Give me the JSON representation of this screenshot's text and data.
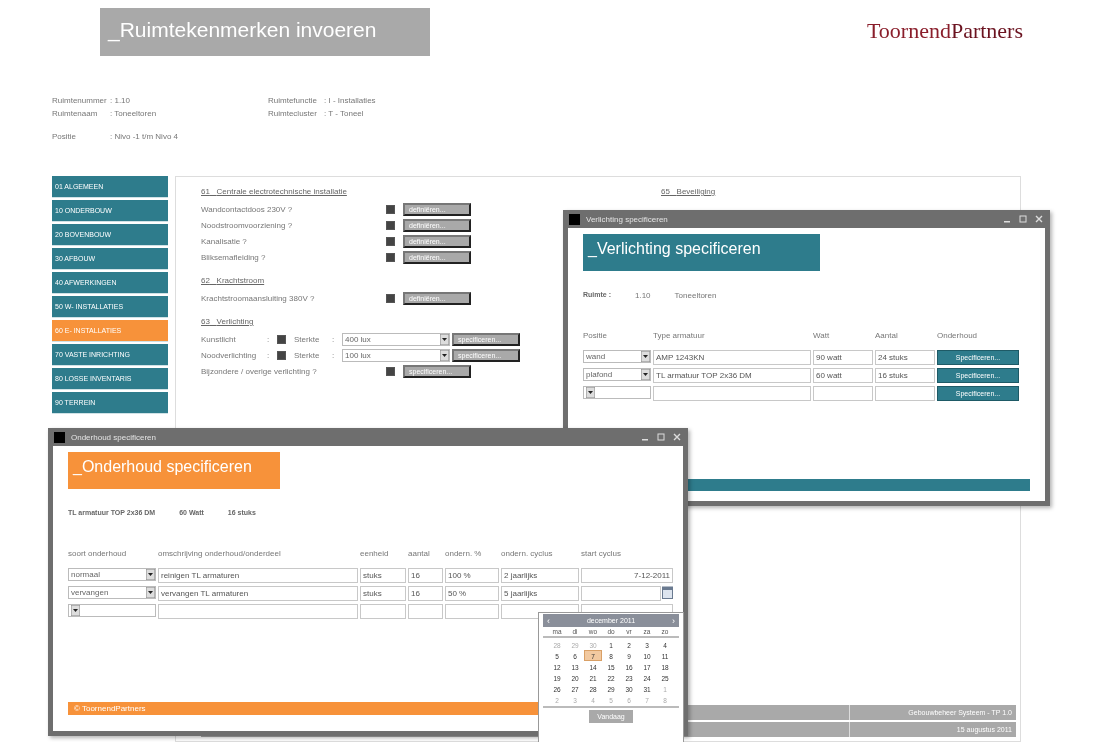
{
  "header": {
    "title": "_Ruimtekenmerken invoeren",
    "logo_first": "Toornend",
    "logo_second": "Partners"
  },
  "room_info": {
    "left": [
      {
        "label": "Ruimtenummer",
        "value": ": 1.10"
      },
      {
        "label": "Ruimtenaam",
        "value": ": Toneeltoren"
      },
      {
        "label": "Positie",
        "value": ": Nivo -1 t/m Nivo 4"
      }
    ],
    "right": [
      {
        "label": "Ruimtefunctie",
        "value": ": I - Installaties"
      },
      {
        "label": "Ruimtecluster",
        "value": ": T - Toneel"
      }
    ]
  },
  "sidebar": [
    {
      "label": "01 ALGEMEEN",
      "selected": false
    },
    {
      "label": "10 ONDERBOUW",
      "selected": false
    },
    {
      "label": "20 BOVENBOUW",
      "selected": false
    },
    {
      "label": "30 AFBOUW",
      "selected": false
    },
    {
      "label": "40 AFWERKINGEN",
      "selected": false
    },
    {
      "label": "50 W- INSTALLATIES",
      "selected": false
    },
    {
      "label": "60 E- INSTALLATIES",
      "selected": true
    },
    {
      "label": "70 VASTE INRICHTING",
      "selected": false
    },
    {
      "label": "80 LOSSE INVENTARIS",
      "selected": false
    },
    {
      "label": "90 TERREIN",
      "selected": false
    }
  ],
  "sections": [
    {
      "number": "61",
      "title": "Centrale electrotechnische installatie",
      "rows": [
        {
          "kind": "check",
          "label": "Wandcontactdoos 230V ?",
          "checked": true,
          "button": "definiëren..."
        },
        {
          "kind": "check",
          "label": "Noodstroomvoorziening ?",
          "checked": true,
          "button": "definiëren..."
        },
        {
          "kind": "check",
          "label": "Kanalisatie ?",
          "checked": true,
          "button": "definiëren..."
        },
        {
          "kind": "check",
          "label": "Bliksemafleiding ?",
          "checked": true,
          "button": "definiëren..."
        }
      ]
    },
    {
      "number": "62",
      "title": "Krachtstroom",
      "rows": [
        {
          "kind": "check",
          "label": "Krachtstroomaansluiting 380V ?",
          "checked": true,
          "button": "definiëren..."
        }
      ]
    },
    {
      "number": "63",
      "title": "Verlichting",
      "rows": [
        {
          "kind": "strength",
          "label": "Kunstlicht",
          "colon": ":",
          "checked": true,
          "strength_label": "Sterkte",
          "strength_colon": ":",
          "value": "400 lux",
          "button": "specificeren..."
        },
        {
          "kind": "strength",
          "label": "Noodverlichting",
          "colon": ":",
          "checked": true,
          "strength_label": "Sterkte",
          "strength_colon": ":",
          "value": "100 lux",
          "button": "specificeren..."
        },
        {
          "kind": "check",
          "label": "Bijzondere / overige verlichting ?",
          "checked": true,
          "button": "specificeren..."
        }
      ]
    }
  ],
  "right_section": {
    "number": "65",
    "title": "Beveiliging"
  },
  "status_bar": [
    "Gebouwbeheer Systeem - TP 1.0",
    "15 augustus 2011"
  ],
  "lighting_window": {
    "title": "Verlichting specificeren",
    "heading": "_Verlichting specificeren",
    "room_label": "Ruimte :",
    "room_number": "1.10",
    "room_name": "Toneeltoren",
    "columns": [
      "Positie",
      "Type armatuur",
      "Watt",
      "Aantal",
      "Onderhoud"
    ],
    "rows": [
      {
        "position": "wand",
        "type": "AMP 1243KN",
        "watt": "90 watt",
        "count": "24 stuks",
        "button": "Specificeren..."
      },
      {
        "position": "plafond",
        "type": "TL armatuur TOP 2x36 DM",
        "watt": "60 watt",
        "count": "16 stuks",
        "button": "Specificeren..."
      },
      {
        "button": "Specificeren..."
      }
    ]
  },
  "maintenance_window": {
    "title": "Onderhoud specificeren",
    "heading": "_Onderhoud specificeren",
    "fixture": [
      "TL armatuur TOP 2x36 DM",
      "60 Watt",
      "16 stuks"
    ],
    "columns": [
      "soort onderhoud",
      "omschrijving onderhoud/onderdeel",
      "eenheid",
      "aantal",
      "ondern. %",
      "ondern. cyclus",
      "start cyclus"
    ],
    "rows": [
      {
        "cells": [
          "normaal",
          "reinigen TL armaturen",
          "stuks",
          "16",
          "100 %",
          "2 jaarlijks",
          "7-12-2011"
        ],
        "date_picker_open": false
      },
      {
        "cells": [
          "vervangen",
          "vervangen TL armaturen",
          "stuks",
          "16",
          "50 %",
          "5 jaarlijks"
        ],
        "date_picker_open": true
      },
      {
        "cells": [],
        "date_picker_open": false
      }
    ],
    "footer": "© ToornendPartners"
  },
  "calendar": {
    "month": "december 2011",
    "prev": "‹",
    "next": "›",
    "weekdays": [
      "ma",
      "di",
      "wo",
      "do",
      "vr",
      "za",
      "zo"
    ],
    "weeks": [
      [
        {
          "day": "28",
          "other_month": true,
          "selected": false
        },
        {
          "day": "29",
          "other_month": true,
          "selected": false
        },
        {
          "day": "30",
          "other_month": true,
          "selected": false
        },
        {
          "day": "1",
          "other_month": false,
          "selected": false
        },
        {
          "day": "2",
          "other_month": false,
          "selected": false
        },
        {
          "day": "3",
          "other_month": false,
          "selected": false
        },
        {
          "day": "4",
          "other_month": false,
          "selected": false
        }
      ],
      [
        {
          "day": "5",
          "other_month": false,
          "selected": false
        },
        {
          "day": "6",
          "other_month": false,
          "selected": false
        },
        {
          "day": "7",
          "other_month": false,
          "selected": true
        },
        {
          "day": "8",
          "other_month": false,
          "selected": false
        },
        {
          "day": "9",
          "other_month": false,
          "selected": false
        },
        {
          "day": "10",
          "other_month": false,
          "selected": false
        },
        {
          "day": "11",
          "other_month": false,
          "selected": false
        }
      ],
      [
        {
          "day": "12",
          "other_month": false,
          "selected": false
        },
        {
          "day": "13",
          "other_month": false,
          "selected": false
        },
        {
          "day": "14",
          "other_month": false,
          "selected": false
        },
        {
          "day": "15",
          "other_month": false,
          "selected": false
        },
        {
          "day": "16",
          "other_month": false,
          "selected": false
        },
        {
          "day": "17",
          "other_month": false,
          "selected": false
        },
        {
          "day": "18",
          "other_month": false,
          "selected": false
        }
      ],
      [
        {
          "day": "19",
          "other_month": false,
          "selected": false
        },
        {
          "day": "20",
          "other_month": false,
          "selected": false
        },
        {
          "day": "21",
          "other_month": false,
          "selected": false
        },
        {
          "day": "22",
          "other_month": false,
          "selected": false
        },
        {
          "day": "23",
          "other_month": false,
          "selected": false
        },
        {
          "day": "24",
          "other_month": false,
          "selected": false
        },
        {
          "day": "25",
          "other_month": false,
          "selected": false
        }
      ],
      [
        {
          "day": "26",
          "other_month": false,
          "selected": false
        },
        {
          "day": "27",
          "other_month": false,
          "selected": false
        },
        {
          "day": "28",
          "other_month": false,
          "selected": false
        },
        {
          "day": "29",
          "other_month": false,
          "selected": false
        },
        {
          "day": "30",
          "other_month": false,
          "selected": false
        },
        {
          "day": "31",
          "other_month": false,
          "selected": false
        },
        {
          "day": "1",
          "other_month": true,
          "selected": false
        }
      ],
      [
        {
          "day": "2",
          "other_month": true,
          "selected": false
        },
        {
          "day": "3",
          "other_month": true,
          "selected": false
        },
        {
          "day": "4",
          "other_month": true,
          "selected": false
        },
        {
          "day": "5",
          "other_month": true,
          "selected": false
        },
        {
          "day": "6",
          "other_month": true,
          "selected": false
        },
        {
          "day": "7",
          "other_month": true,
          "selected": false
        },
        {
          "day": "8",
          "other_month": true,
          "selected": false
        }
      ]
    ],
    "today_button": "Vandaag"
  }
}
